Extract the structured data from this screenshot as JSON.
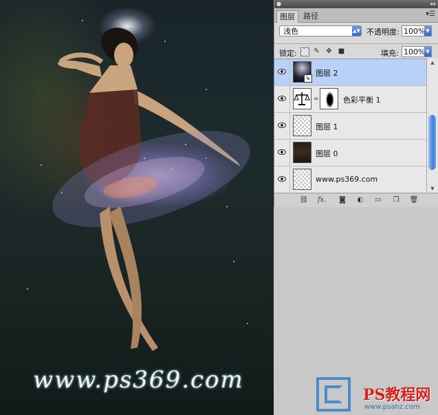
{
  "panel": {
    "tabs": [
      "图层",
      "路径"
    ],
    "blend_mode": "浅色",
    "opacity_label": "不透明度:",
    "opacity_value": "100%",
    "lock_label": "锁定:",
    "fill_label": "填充:",
    "fill_value": "100%",
    "layers": [
      {
        "name": "图层 2",
        "selected": true,
        "visible": true
      },
      {
        "name": "色彩平衡 1",
        "selected": false,
        "visible": true
      },
      {
        "name": "图层 1",
        "selected": false,
        "visible": true
      },
      {
        "name": "图层 0",
        "selected": false,
        "visible": true
      },
      {
        "name": "www.ps369.com",
        "selected": false,
        "visible": true
      }
    ],
    "bottom_icons": [
      "link-icon",
      "fx-icon",
      "mask-icon",
      "adjustment-icon",
      "group-icon",
      "new-layer-icon",
      "trash-icon"
    ]
  },
  "artwork": {
    "watermark": "www.ps369.com"
  },
  "logo": {
    "text": "PS教程网",
    "url": "www.psahz.com"
  },
  "colors": {
    "selection": "#b9d1f7",
    "accent": "#3d7fdd",
    "logo_red": "#d4231b",
    "logo_blue": "#4a8bc9"
  }
}
